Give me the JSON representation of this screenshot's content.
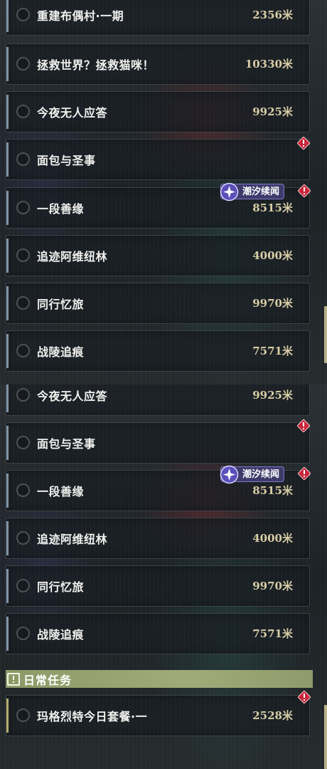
{
  "screen_top": {
    "quests": [
      {
        "name": "重建布偶村·一期",
        "distance": "2356米",
        "warning": false
      },
      {
        "name": "拯救世界？拯救猫咪！",
        "distance": "10330米",
        "warning": false
      },
      {
        "name": "今夜无人应答",
        "distance": "9925米",
        "warning": false
      },
      {
        "name": "面包与圣事",
        "distance": "",
        "warning": true
      },
      {
        "name": "一段善缘",
        "distance": "8515米",
        "warning": true,
        "tag": "潮汐续闻"
      },
      {
        "name": "追迹阿维纽林",
        "distance": "4000米",
        "warning": false
      },
      {
        "name": "同行忆旅",
        "distance": "9970米",
        "warning": false
      },
      {
        "name": "战陵追痕",
        "distance": "7571米",
        "warning": false
      }
    ]
  },
  "screen_bottom": {
    "quests": [
      {
        "name": "今夜无人应答",
        "distance": "9925米",
        "warning": false
      },
      {
        "name": "面包与圣事",
        "distance": "",
        "warning": true
      },
      {
        "name": "一段善缘",
        "distance": "8515米",
        "warning": true,
        "tag": "潮汐续闻"
      },
      {
        "name": "追迹阿维纽林",
        "distance": "4000米",
        "warning": false
      },
      {
        "name": "同行忆旅",
        "distance": "9970米",
        "warning": false
      },
      {
        "name": "战陵追痕",
        "distance": "7571米",
        "warning": false
      }
    ],
    "daily_section": {
      "title": "日常任务",
      "icon": "exclamation-box-icon",
      "quests": [
        {
          "name": "玛格烈特今日套餐·一",
          "distance": "2528米",
          "warning": true
        }
      ]
    }
  },
  "colors": {
    "accent_main": "#7f93a6",
    "accent_daily": "#b3ad6c",
    "distance_text": "#d7cda5",
    "warning_red": "#c8253a",
    "tag_bg": "#3d3a6a",
    "section_bg": "#a0ab79"
  }
}
